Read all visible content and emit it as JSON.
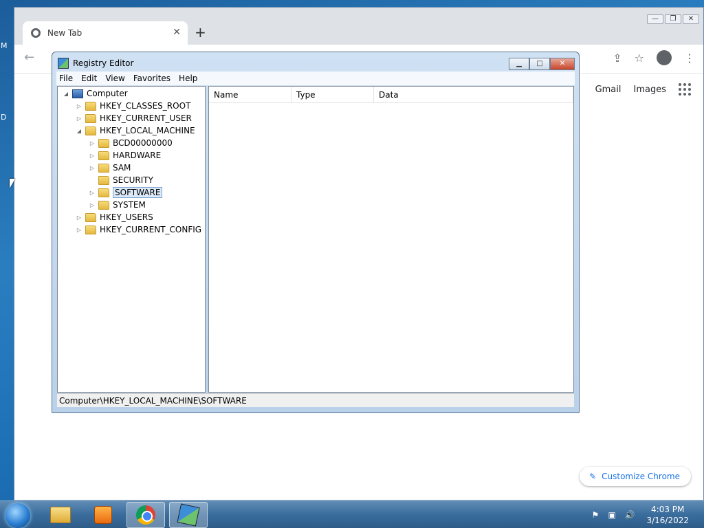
{
  "desktop": {
    "fragments": [
      "M",
      "D"
    ]
  },
  "chrome": {
    "tab_title": "New Tab",
    "tab_close": "✕",
    "newtab": "+",
    "links": [
      "Gmail",
      "Images"
    ],
    "customize_label": "Customize Chrome",
    "window_controls": [
      "—",
      "❐",
      "✕"
    ]
  },
  "regedit": {
    "title": "Registry Editor",
    "menu": [
      "File",
      "Edit",
      "View",
      "Favorites",
      "Help"
    ],
    "tree": {
      "root": "Computer",
      "hives": [
        "HKEY_CLASSES_ROOT",
        "HKEY_CURRENT_USER",
        "HKEY_LOCAL_MACHINE",
        "HKEY_USERS",
        "HKEY_CURRENT_CONFIG"
      ],
      "hklm_children": [
        "BCD00000000",
        "HARDWARE",
        "SAM",
        "SECURITY",
        "SOFTWARE",
        "SYSTEM"
      ],
      "selected": "SOFTWARE"
    },
    "columns": [
      "Name",
      "Type",
      "Data"
    ],
    "status_path": "Computer\\HKEY_LOCAL_MACHINE\\SOFTWARE"
  },
  "taskbar": {
    "clock_time": "4:03 PM",
    "clock_date": "3/16/2022",
    "pinned": [
      "explorer-icon",
      "media-player-icon",
      "chrome-icon",
      "registry-editor-icon"
    ],
    "active": "registry-editor-icon"
  }
}
